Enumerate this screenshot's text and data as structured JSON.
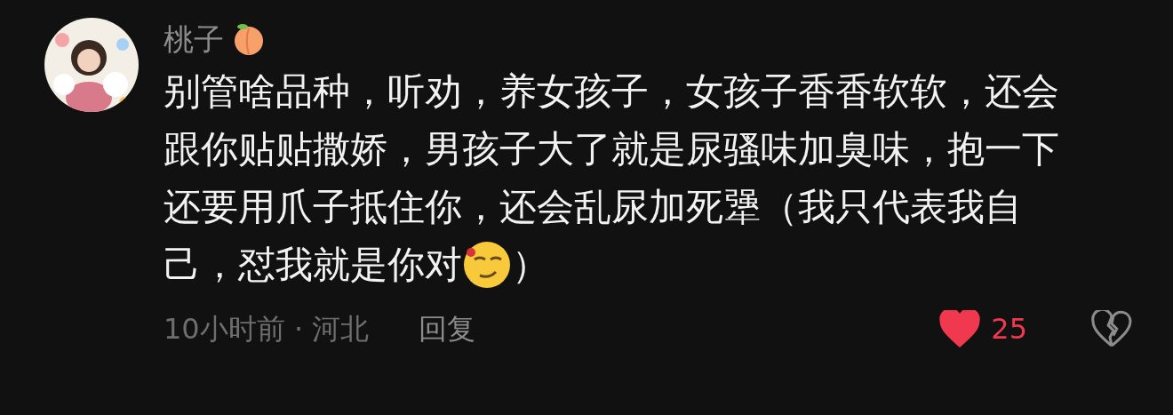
{
  "comment": {
    "username": "桃子",
    "lines": [
      "别管啥品种，听劝，养女孩子，女孩子香香软软，还会",
      "跟你贴贴撒娇，男孩子大了就是尿骚味加臭味，抱一下",
      "还要用爪子抵住你，还会乱尿加死犟（我只代表我自",
      "己，怼我就是你对"
    ],
    "text_after_emoji": "）",
    "time": "10小时前 · 河北",
    "reply": "回复",
    "liked": true,
    "likes": "25"
  }
}
